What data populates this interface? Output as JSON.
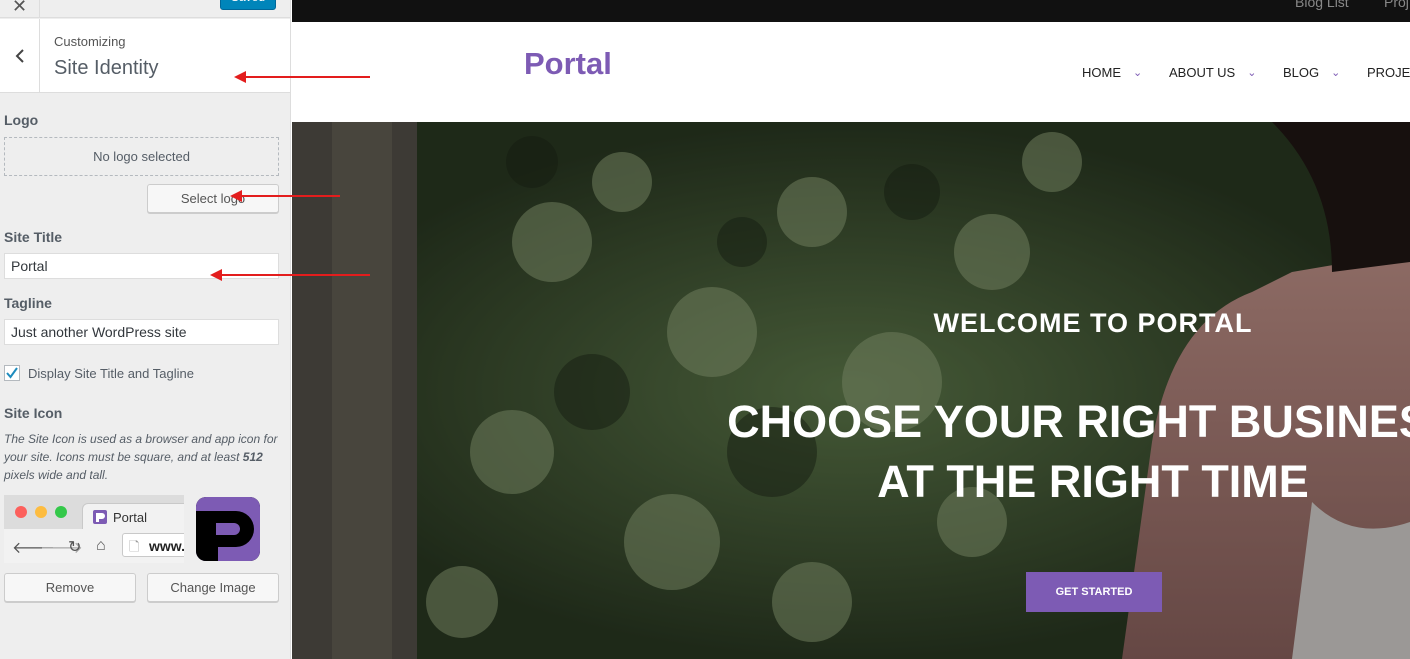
{
  "customizer": {
    "close_icon": "close-icon",
    "save_label": "Saved",
    "breadcrumb": "Customizing",
    "section_title": "Site Identity",
    "logo": {
      "label": "Logo",
      "placeholder": "No logo selected",
      "select_button": "Select logo"
    },
    "site_title": {
      "label": "Site Title",
      "value": "Portal"
    },
    "tagline": {
      "label": "Tagline",
      "value": "Just another WordPress site"
    },
    "display_toggle": {
      "label": "Display Site Title and Tagline",
      "checked": true
    },
    "site_icon": {
      "label": "Site Icon",
      "desc_before": "The Site Icon is used as a browser and app icon for your site. Icons must be square, and at least ",
      "desc_bold": "512",
      "desc_after": " pixels wide and tall.",
      "browser_tab_label": "Portal",
      "browser_url": "www.",
      "remove_button": "Remove",
      "change_button": "Change Image"
    }
  },
  "preview": {
    "top_links": [
      "Blog List",
      "Proj"
    ],
    "brand": "Portal",
    "nav": [
      "HOME",
      "ABOUT US",
      "BLOG",
      "PROJEC"
    ],
    "hero": {
      "welcome": "WELCOME TO PORTAL",
      "headline_1": "CHOOSE YOUR RIGHT BUSINESS",
      "headline_2": "AT THE RIGHT TIME",
      "cta": "GET STARTED"
    }
  },
  "colors": {
    "brand_purple": "#7d5bb4",
    "wp_blue": "#0085ba",
    "annotation_red": "#e31d1d"
  }
}
